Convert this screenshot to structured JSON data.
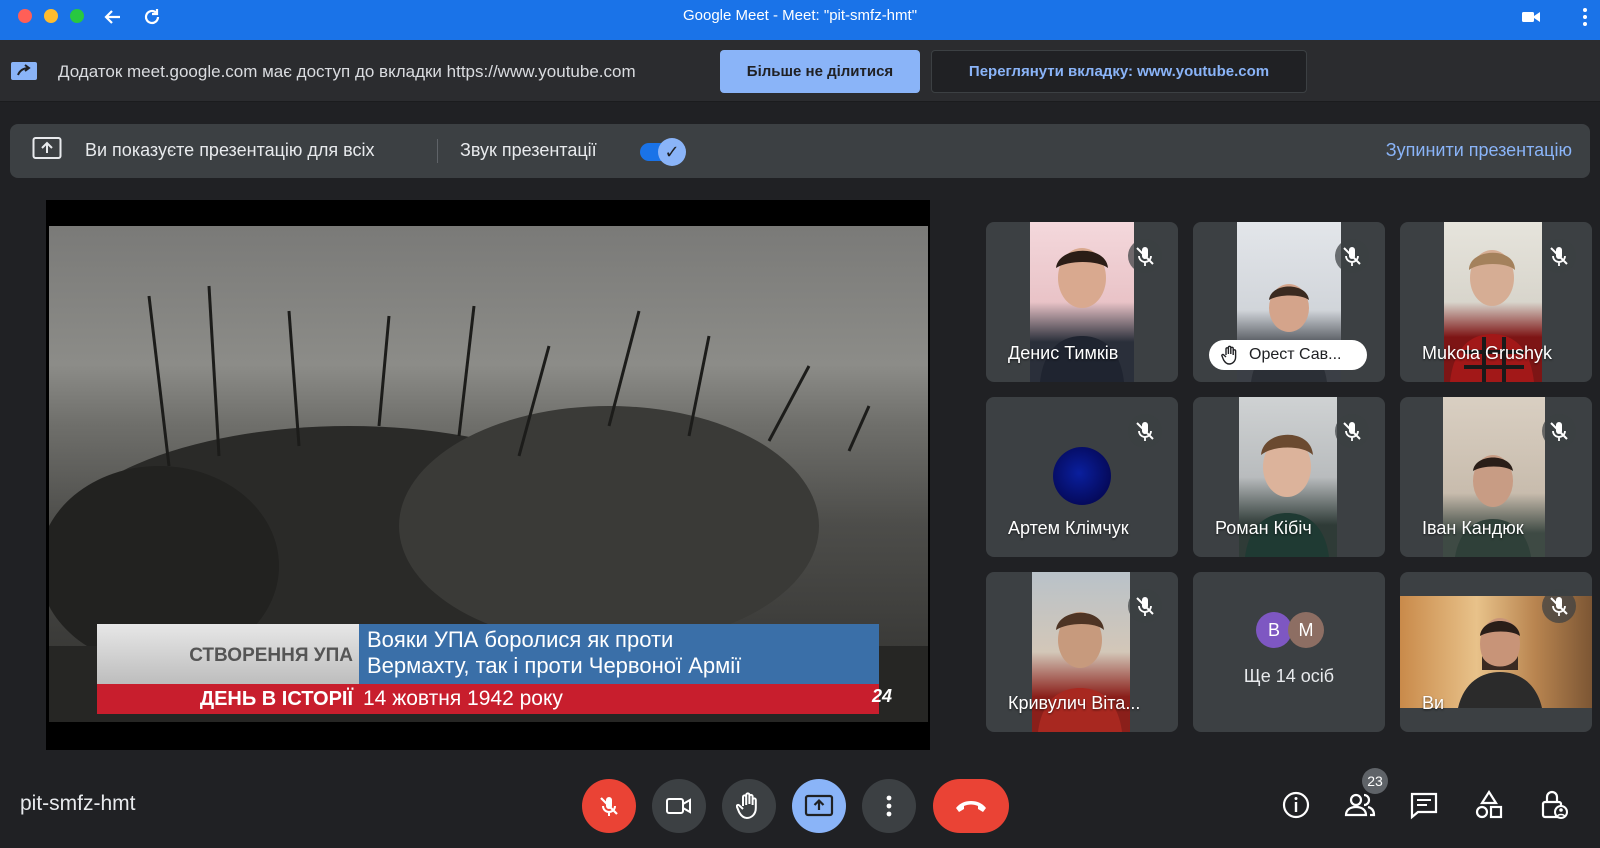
{
  "window": {
    "title": "Google Meet - Meet: \"pit-smfz-hmt\""
  },
  "infobar": {
    "message": "Додаток meet.google.com має доступ до вкладки https://www.youtube.com",
    "stop_sharing_label": "Більше не ділитися",
    "view_tab_label": "Переглянути вкладку: www.youtube.com"
  },
  "presentation_banner": {
    "text": "Ви показуєте презентацію для всіх",
    "sound_label": "Звук презентації",
    "sound_enabled": true,
    "stop_label": "Зупинити презентацію"
  },
  "video": {
    "ticker_topic": "СТВОРЕННЯ УПА",
    "ticker_headline_line1": "Вояки УПА боролися як проти",
    "ticker_headline_line2": "Вермахту, так і проти Червоної Армії",
    "ticker_section": "ДЕНЬ В ІСТОРІЇ",
    "ticker_date": "14 жовтня 1942 року",
    "channel_logo": "24"
  },
  "participants": [
    {
      "name": "Денис Тимків",
      "muted": true
    },
    {
      "name": "Орест Сав...",
      "muted": true,
      "hand_raised": true
    },
    {
      "name": "Mukola Grushyk",
      "muted": true
    },
    {
      "name": "Артем Клімчук",
      "muted": true
    },
    {
      "name": "Роман Кібіч",
      "muted": true
    },
    {
      "name": "Іван Кандюк",
      "muted": true
    },
    {
      "name": "Кривулич Віта...",
      "muted": true
    },
    {
      "more_label": "Ще 14 осіб",
      "avatars": [
        "В",
        "М"
      ]
    },
    {
      "name": "Ви",
      "muted": true
    }
  ],
  "bottom_bar": {
    "meeting_code": "pit-smfz-hmt",
    "participants_count": "23"
  },
  "colors": {
    "titlebar": "#1a73e8",
    "accent": "#8ab4f8",
    "end_call": "#ea4335",
    "background": "#202124"
  }
}
